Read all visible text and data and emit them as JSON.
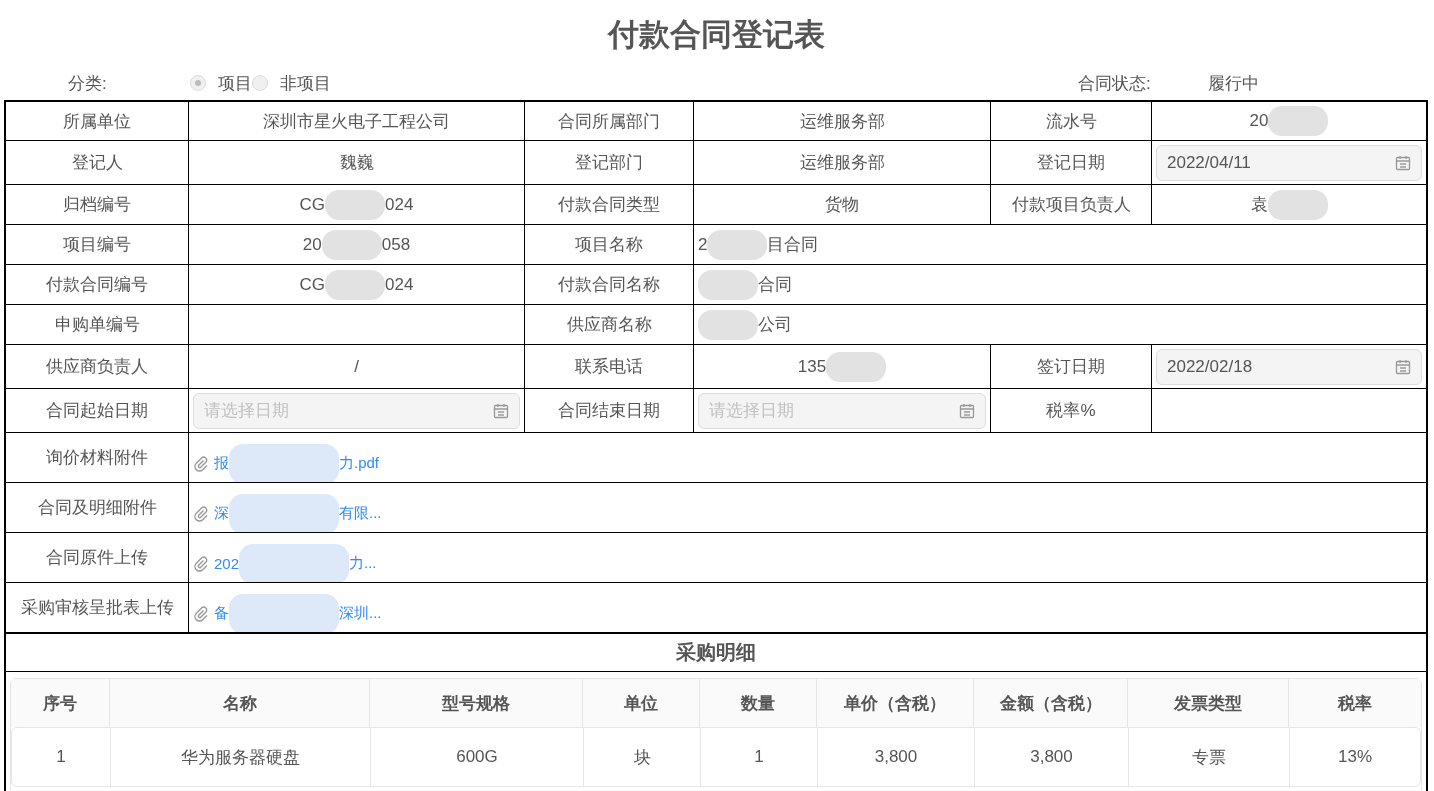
{
  "title": "付款合同登记表",
  "category": {
    "label": "分类:",
    "options": [
      {
        "label": "项目",
        "selected": true
      },
      {
        "label": "非项目",
        "selected": false
      }
    ]
  },
  "status": {
    "label": "合同状态:",
    "value": "履行中"
  },
  "form_rows": [
    {
      "cells": [
        {
          "kind": "label",
          "text": "所属单位"
        },
        {
          "kind": "text",
          "segments": [
            {
              "kind": "text",
              "text": "深圳市星火电子工程公司"
            }
          ]
        },
        {
          "kind": "label",
          "text": "合同所属部门"
        },
        {
          "kind": "text",
          "segments": [
            {
              "kind": "text",
              "text": "运维服务部"
            }
          ]
        },
        {
          "kind": "label",
          "text": "流水号"
        },
        {
          "kind": "text",
          "segments": [
            {
              "kind": "text",
              "text": "20"
            },
            {
              "kind": "blur"
            }
          ]
        }
      ]
    },
    {
      "cells": [
        {
          "kind": "label",
          "text": "登记人"
        },
        {
          "kind": "text",
          "segments": [
            {
              "kind": "text",
              "text": "魏巍"
            }
          ]
        },
        {
          "kind": "label",
          "text": "登记部门"
        },
        {
          "kind": "text",
          "segments": [
            {
              "kind": "text",
              "text": "运维服务部"
            }
          ]
        },
        {
          "kind": "label",
          "text": "登记日期"
        },
        {
          "kind": "date",
          "value": "2022/04/11"
        }
      ]
    },
    {
      "cells": [
        {
          "kind": "label",
          "text": "归档编号"
        },
        {
          "kind": "text",
          "segments": [
            {
              "kind": "text",
              "text": "CG"
            },
            {
              "kind": "blur"
            },
            {
              "kind": "text",
              "text": "024"
            }
          ]
        },
        {
          "kind": "label",
          "text": "付款合同类型"
        },
        {
          "kind": "text",
          "segments": [
            {
              "kind": "text",
              "text": "货物"
            }
          ]
        },
        {
          "kind": "label",
          "text": "付款项目负责人"
        },
        {
          "kind": "text",
          "segments": [
            {
              "kind": "text",
              "text": "袁"
            },
            {
              "kind": "blur"
            }
          ]
        }
      ]
    },
    {
      "cells": [
        {
          "kind": "label",
          "text": "项目编号"
        },
        {
          "kind": "text",
          "segments": [
            {
              "kind": "text",
              "text": "20"
            },
            {
              "kind": "blur"
            },
            {
              "kind": "text",
              "text": "058"
            }
          ]
        },
        {
          "kind": "label",
          "text": "项目名称"
        },
        {
          "kind": "wide",
          "segments": [
            {
              "kind": "text",
              "text": "2"
            },
            {
              "kind": "blur"
            },
            {
              "kind": "text",
              "text": "目合同"
            }
          ]
        }
      ]
    },
    {
      "cells": [
        {
          "kind": "label",
          "text": "付款合同编号"
        },
        {
          "kind": "text",
          "segments": [
            {
              "kind": "text",
              "text": "CG"
            },
            {
              "kind": "blur"
            },
            {
              "kind": "text",
              "text": "024"
            }
          ]
        },
        {
          "kind": "label",
          "text": "付款合同名称"
        },
        {
          "kind": "wide",
          "segments": [
            {
              "kind": "blur"
            },
            {
              "kind": "text",
              "text": "合同"
            }
          ]
        }
      ]
    },
    {
      "cells": [
        {
          "kind": "label",
          "text": "申购单编号"
        },
        {
          "kind": "empty"
        },
        {
          "kind": "label",
          "text": "供应商名称"
        },
        {
          "kind": "wide",
          "segments": [
            {
              "kind": "blur"
            },
            {
              "kind": "text",
              "text": "公司"
            }
          ]
        }
      ]
    },
    {
      "cells": [
        {
          "kind": "label",
          "text": "供应商负责人"
        },
        {
          "kind": "text",
          "segments": [
            {
              "kind": "text",
              "text": "/"
            }
          ]
        },
        {
          "kind": "label",
          "text": "联系电话"
        },
        {
          "kind": "text",
          "segments": [
            {
              "kind": "text",
              "text": "135"
            },
            {
              "kind": "blur"
            }
          ]
        },
        {
          "kind": "label",
          "text": "签订日期"
        },
        {
          "kind": "date",
          "value": "2022/02/18"
        }
      ]
    },
    {
      "cells": [
        {
          "kind": "label",
          "text": "合同起始日期"
        },
        {
          "kind": "date",
          "placeholder": "请选择日期"
        },
        {
          "kind": "label",
          "text": "合同结束日期"
        },
        {
          "kind": "date",
          "placeholder": "请选择日期"
        },
        {
          "kind": "label",
          "text": "税率%"
        },
        {
          "kind": "empty"
        }
      ]
    },
    {
      "cells": [
        {
          "kind": "label",
          "text": "询价材料附件"
        },
        {
          "kind": "file",
          "segments": [
            {
              "kind": "text",
              "text": "报"
            },
            {
              "kind": "blur"
            },
            {
              "kind": "text",
              "text": "力.pdf"
            }
          ]
        }
      ]
    },
    {
      "cells": [
        {
          "kind": "label",
          "text": "合同及明细附件"
        },
        {
          "kind": "file",
          "segments": [
            {
              "kind": "text",
              "text": "深"
            },
            {
              "kind": "blur"
            },
            {
              "kind": "text",
              "text": "有限..."
            }
          ]
        }
      ]
    },
    {
      "cells": [
        {
          "kind": "label",
          "text": "合同原件上传"
        },
        {
          "kind": "file",
          "segments": [
            {
              "kind": "text",
              "text": "202"
            },
            {
              "kind": "blur"
            },
            {
              "kind": "text",
              "text": "力..."
            }
          ]
        }
      ]
    },
    {
      "cells": [
        {
          "kind": "label",
          "text": "采购审核呈批表上传"
        },
        {
          "kind": "file",
          "segments": [
            {
              "kind": "text",
              "text": "备"
            },
            {
              "kind": "blur"
            },
            {
              "kind": "text",
              "text": "深圳..."
            }
          ]
        }
      ]
    }
  ],
  "details": {
    "title": "采购明细",
    "columns": [
      "序号",
      "名称",
      "型号规格",
      "单位",
      "数量",
      "单价（含税）",
      "金额（含税）",
      "发票类型",
      "税率"
    ],
    "rows": [
      [
        "1",
        "华为服务器硬盘",
        "600G",
        "块",
        "1",
        "3,800",
        "3,800",
        "专票",
        "13%"
      ]
    ]
  }
}
